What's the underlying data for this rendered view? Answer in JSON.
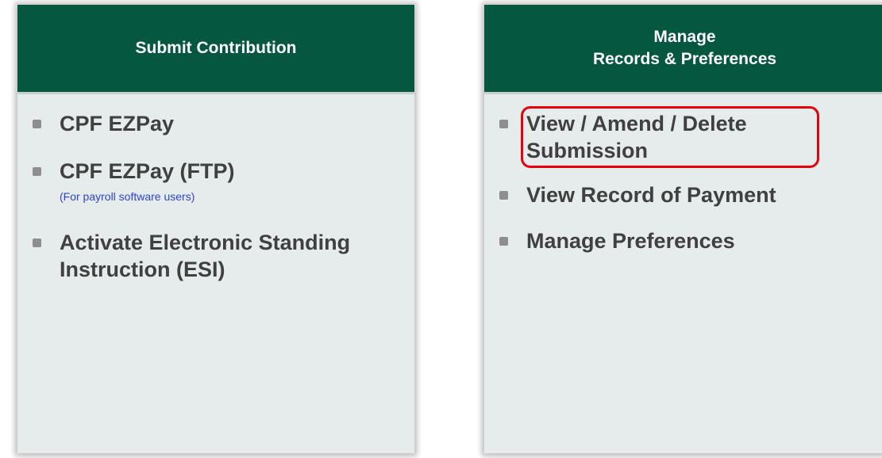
{
  "left_card": {
    "header_title": "Submit Contribution",
    "items": [
      {
        "label": "CPF EZPay",
        "note": ""
      },
      {
        "label": "CPF EZPay (FTP)",
        "note": "(For payroll software users)"
      },
      {
        "label": "Activate Electronic Standing Instruction (ESI)",
        "note": ""
      }
    ]
  },
  "right_card": {
    "header_line1": "Manage",
    "header_line2": "Records & Preferences",
    "items": [
      {
        "label": "View / Amend / Delete Submission"
      },
      {
        "label": "View Record of Payment"
      },
      {
        "label": "Manage Preferences"
      }
    ]
  },
  "colors": {
    "header_bg": "#05573f",
    "card_bg": "#e6eceb",
    "item_text": "#404040",
    "note_text": "#2e44d8",
    "highlight": "#e8000b"
  },
  "icons": {
    "bullet": "square-bullet-icon"
  }
}
